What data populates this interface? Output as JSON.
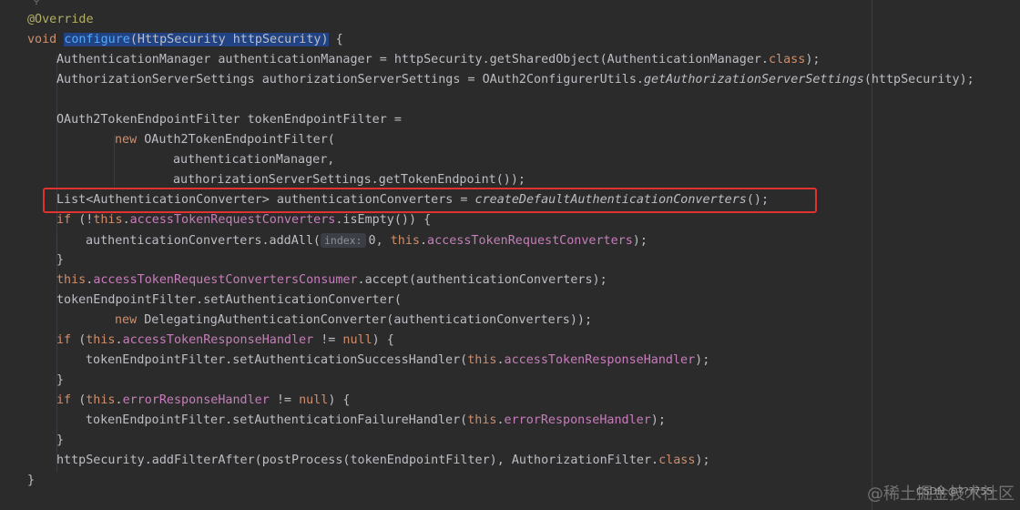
{
  "editor": {
    "lines": [
      {
        "id": "l1",
        "segments": [
          {
            "t": "@Override",
            "c": "ann"
          }
        ]
      },
      {
        "id": "l2",
        "segments": [
          {
            "t": "void ",
            "c": "kw"
          },
          {
            "t": "configure",
            "c": "fn sel"
          },
          {
            "t": "(HttpSecurity httpSecurity)",
            "c": "sel"
          },
          {
            "t": " {",
            "c": ""
          }
        ]
      },
      {
        "id": "l3",
        "segments": [
          {
            "t": "AuthenticationManager authenticationManager = httpSecurity.getSharedObject(AuthenticationManager.",
            "c": ""
          },
          {
            "t": "class",
            "c": "kw"
          },
          {
            "t": ");",
            "c": ""
          }
        ]
      },
      {
        "id": "l4",
        "segments": [
          {
            "t": "AuthorizationServerSettings authorizationServerSettings = OAuth2ConfigurerUtils.",
            "c": ""
          },
          {
            "t": "getAuthorizationServerSettings",
            "c": "it"
          },
          {
            "t": "(httpSecurity);",
            "c": ""
          }
        ]
      },
      {
        "id": "l5",
        "segments": []
      },
      {
        "id": "l6",
        "segments": [
          {
            "t": "OAuth2TokenEndpointFilter tokenEndpointFilter =",
            "c": ""
          }
        ]
      },
      {
        "id": "l7",
        "segments": [
          {
            "t": "new ",
            "c": "kw"
          },
          {
            "t": "OAuth2TokenEndpointFilter(",
            "c": ""
          }
        ]
      },
      {
        "id": "l8",
        "segments": [
          {
            "t": "authenticationManager,",
            "c": ""
          }
        ]
      },
      {
        "id": "l9",
        "segments": [
          {
            "t": "authorizationServerSettings.getTokenEndpoint());",
            "c": ""
          }
        ]
      },
      {
        "id": "l10",
        "segments": [
          {
            "t": "List<AuthenticationConverter> authenticationConverters = ",
            "c": ""
          },
          {
            "t": "createDefaultAuthenticationConverters",
            "c": "it"
          },
          {
            "t": "();",
            "c": ""
          }
        ]
      },
      {
        "id": "l11",
        "segments": [
          {
            "t": "if ",
            "c": "kw"
          },
          {
            "t": "(!",
            "c": ""
          },
          {
            "t": "this",
            "c": "kw"
          },
          {
            "t": ".",
            "c": ""
          },
          {
            "t": "accessTokenRequestConverters",
            "c": "purple"
          },
          {
            "t": ".isEmpty()) {",
            "c": ""
          }
        ]
      },
      {
        "id": "l12",
        "segments": [
          {
            "t": "authenticationConverters.addAll(",
            "c": ""
          },
          {
            "t": "index:",
            "c": "hint"
          },
          {
            "t": "0, ",
            "c": ""
          },
          {
            "t": "this",
            "c": "kw"
          },
          {
            "t": ".",
            "c": ""
          },
          {
            "t": "accessTokenRequestConverters",
            "c": "purple"
          },
          {
            "t": ");",
            "c": ""
          }
        ]
      },
      {
        "id": "l13",
        "segments": [
          {
            "t": "}",
            "c": ""
          }
        ]
      },
      {
        "id": "l14",
        "segments": [
          {
            "t": "this",
            "c": "kw"
          },
          {
            "t": ".",
            "c": ""
          },
          {
            "t": "accessTokenRequestConvertersConsumer",
            "c": "purple"
          },
          {
            "t": ".accept(authenticationConverters);",
            "c": ""
          }
        ]
      },
      {
        "id": "l15",
        "segments": [
          {
            "t": "tokenEndpointFilter.setAuthenticationConverter(",
            "c": ""
          }
        ]
      },
      {
        "id": "l16",
        "segments": [
          {
            "t": "new ",
            "c": "kw"
          },
          {
            "t": "DelegatingAuthenticationConverter(authenticationConverters));",
            "c": ""
          }
        ]
      },
      {
        "id": "l17",
        "segments": [
          {
            "t": "if ",
            "c": "kw"
          },
          {
            "t": "(",
            "c": ""
          },
          {
            "t": "this",
            "c": "kw"
          },
          {
            "t": ".",
            "c": ""
          },
          {
            "t": "accessTokenResponseHandler",
            "c": "purple"
          },
          {
            "t": " != ",
            "c": ""
          },
          {
            "t": "null",
            "c": "kw"
          },
          {
            "t": ") {",
            "c": ""
          }
        ]
      },
      {
        "id": "l18",
        "segments": [
          {
            "t": "tokenEndpointFilter.setAuthenticationSuccessHandler(",
            "c": ""
          },
          {
            "t": "this",
            "c": "kw"
          },
          {
            "t": ".",
            "c": ""
          },
          {
            "t": "accessTokenResponseHandler",
            "c": "purple"
          },
          {
            "t": ");",
            "c": ""
          }
        ]
      },
      {
        "id": "l19",
        "segments": [
          {
            "t": "}",
            "c": ""
          }
        ]
      },
      {
        "id": "l20",
        "segments": [
          {
            "t": "if ",
            "c": "kw"
          },
          {
            "t": "(",
            "c": ""
          },
          {
            "t": "this",
            "c": "kw"
          },
          {
            "t": ".",
            "c": ""
          },
          {
            "t": "errorResponseHandler",
            "c": "purple"
          },
          {
            "t": " != ",
            "c": ""
          },
          {
            "t": "null",
            "c": "kw"
          },
          {
            "t": ") {",
            "c": ""
          }
        ]
      },
      {
        "id": "l21",
        "segments": [
          {
            "t": "tokenEndpointFilter.setAuthenticationFailureHandler(",
            "c": ""
          },
          {
            "t": "this",
            "c": "kw"
          },
          {
            "t": ".",
            "c": ""
          },
          {
            "t": "errorResponseHandler",
            "c": "purple"
          },
          {
            "t": ");",
            "c": ""
          }
        ]
      },
      {
        "id": "l22",
        "segments": [
          {
            "t": "}",
            "c": ""
          }
        ]
      },
      {
        "id": "l23",
        "segments": [
          {
            "t": "httpSecurity.addFilterAfter(postProcess(tokenEndpointFilter), AuthorizationFilter.",
            "c": ""
          },
          {
            "t": "class",
            "c": "kw"
          },
          {
            "t": ");",
            "c": ""
          }
        ]
      },
      {
        "id": "l24",
        "segments": [
          {
            "t": "}",
            "c": ""
          }
        ]
      }
    ]
  },
  "colors": {
    "background": "#2b2b2b",
    "highlight_border": "#e0332f",
    "keyword": "#cf8e6d",
    "field": "#c77dbb",
    "annotation": "#b3ae60"
  },
  "watermark": {
    "main": "@稀土掘金技术社区",
    "sub": "CSDN @???755"
  }
}
